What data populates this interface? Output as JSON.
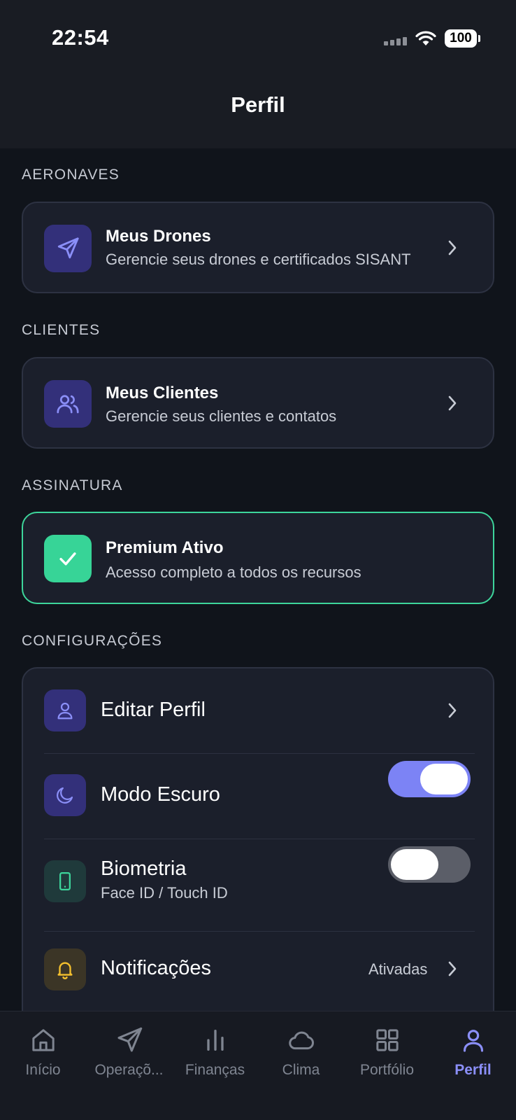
{
  "status_bar": {
    "time": "22:54",
    "battery": "100"
  },
  "header": {
    "title": "Perfil"
  },
  "sections": {
    "aeronaves": {
      "label": "AERONAVES",
      "title": "Meus Drones",
      "subtitle": "Gerencie seus drones e certificados SISANT",
      "icon": "send-icon"
    },
    "clientes": {
      "label": "CLIENTES",
      "title": "Meus Clientes",
      "subtitle": "Gerencie seus clientes e contatos",
      "icon": "users-icon"
    },
    "assinatura": {
      "label": "ASSINATURA",
      "title": "Premium Ativo",
      "subtitle": "Acesso completo a todos os recursos",
      "icon": "check-icon"
    },
    "configuracoes": {
      "label": "CONFIGURAÇÕES",
      "editar_perfil": {
        "title": "Editar Perfil",
        "icon": "user-icon"
      },
      "modo_escuro": {
        "title": "Modo Escuro",
        "icon": "moon-icon",
        "enabled": true
      },
      "biometria": {
        "title": "Biometria",
        "subtitle": "Face ID / Touch ID",
        "icon": "smartphone-icon",
        "enabled": false
      },
      "notificacoes": {
        "title": "Notificações",
        "value": "Ativadas",
        "icon": "bell-icon"
      }
    }
  },
  "tabbar": {
    "tabs": [
      {
        "label": "Início",
        "icon": "home-icon"
      },
      {
        "label": "Operaçõ...",
        "icon": "send-icon"
      },
      {
        "label": "Finanças",
        "icon": "bar-chart-icon"
      },
      {
        "label": "Clima",
        "icon": "cloud-icon"
      },
      {
        "label": "Portfólio",
        "icon": "grid-icon"
      },
      {
        "label": "Perfil",
        "icon": "user-icon"
      }
    ],
    "active": "Perfil"
  },
  "colors": {
    "accent": "#8b8ff8",
    "premium_green": "#3dd59b",
    "toggle_on": "#7c83f5",
    "background": "#10141b",
    "card": "#1b1f2b"
  }
}
